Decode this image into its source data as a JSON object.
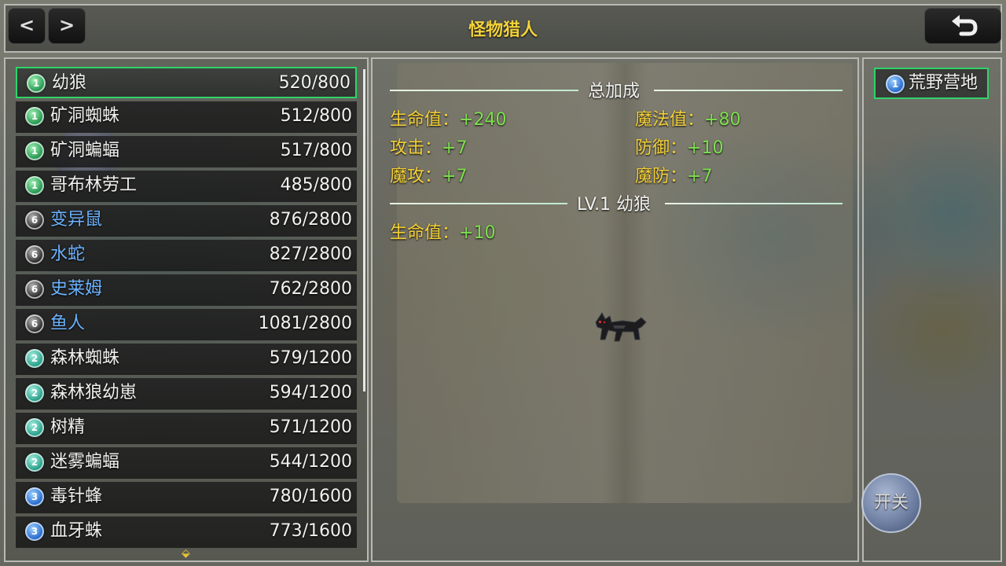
{
  "header": {
    "title": "怪物猎人",
    "prev_label": "<",
    "next_label": ">"
  },
  "monster_list": [
    {
      "level": "1",
      "tier": "green",
      "name": "幼狼",
      "progress": "520/800",
      "rare": false,
      "selected": true
    },
    {
      "level": "1",
      "tier": "green",
      "name": "矿洞蜘蛛",
      "progress": "512/800",
      "rare": false
    },
    {
      "level": "1",
      "tier": "green",
      "name": "矿洞蝙蝠",
      "progress": "517/800",
      "rare": false
    },
    {
      "level": "1",
      "tier": "green",
      "name": "哥布林劳工",
      "progress": "485/800",
      "rare": false
    },
    {
      "level": "6",
      "tier": "black",
      "name": "变异鼠",
      "progress": "876/2800",
      "rare": true
    },
    {
      "level": "6",
      "tier": "black",
      "name": "水蛇",
      "progress": "827/2800",
      "rare": true
    },
    {
      "level": "6",
      "tier": "black",
      "name": "史莱姆",
      "progress": "762/2800",
      "rare": true
    },
    {
      "level": "6",
      "tier": "black",
      "name": "鱼人",
      "progress": "1081/2800",
      "rare": true
    },
    {
      "level": "2",
      "tier": "teal",
      "name": "森林蜘蛛",
      "progress": "579/1200",
      "rare": false
    },
    {
      "level": "2",
      "tier": "teal",
      "name": "森林狼幼崽",
      "progress": "594/1200",
      "rare": false
    },
    {
      "level": "2",
      "tier": "teal",
      "name": "树精",
      "progress": "571/1200",
      "rare": false
    },
    {
      "level": "2",
      "tier": "teal",
      "name": "迷雾蝙蝠",
      "progress": "544/1200",
      "rare": false
    },
    {
      "level": "3",
      "tier": "blue",
      "name": "毒针蜂",
      "progress": "780/1600",
      "rare": false
    },
    {
      "level": "3",
      "tier": "blue",
      "name": "血牙蛛",
      "progress": "773/1600",
      "rare": false
    }
  ],
  "total_bonus": {
    "title": "总加成",
    "stats": [
      {
        "label": "生命值：",
        "value": "+240"
      },
      {
        "label": "魔法值：",
        "value": "+80"
      },
      {
        "label": "攻击：",
        "value": "+7"
      },
      {
        "label": "防御：",
        "value": "+10"
      },
      {
        "label": "魔攻：",
        "value": "+7"
      },
      {
        "label": "魔防：",
        "value": "+7"
      }
    ]
  },
  "level_bonus": {
    "title": "LV.1 幼狼",
    "stats": [
      {
        "label": "生命值：",
        "value": "+10"
      }
    ]
  },
  "region": {
    "level": "1",
    "label": "荒野营地"
  },
  "toggle": {
    "label": "开关"
  },
  "colors": {
    "stat_label": "#f3cf37",
    "stat_value": "#7ee04f",
    "selected_border": "#2fd46a",
    "rare_name": "#6cb2ff",
    "title": "#f2d23a"
  }
}
